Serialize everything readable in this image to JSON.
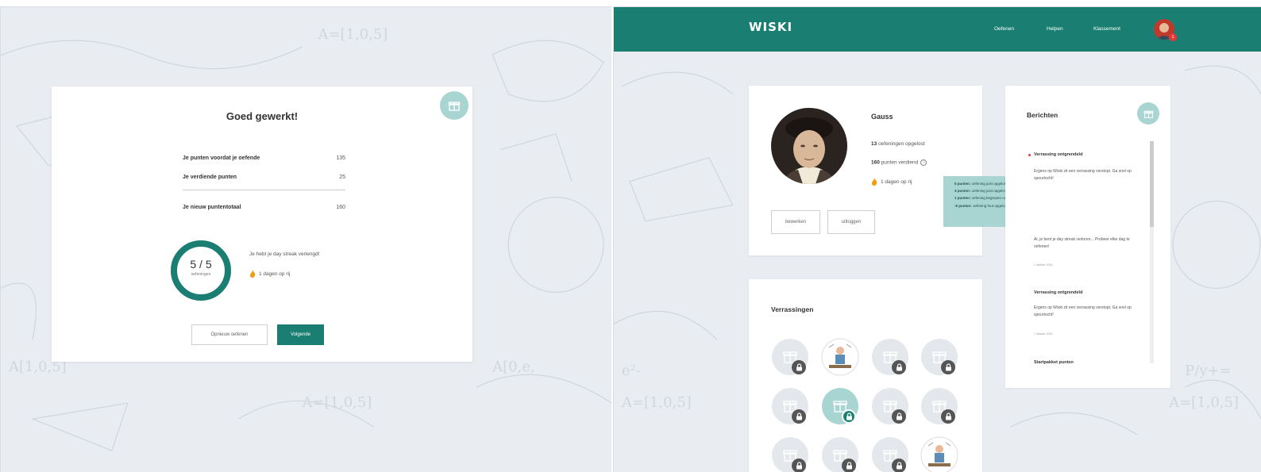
{
  "completion": {
    "title": "Goed gewerkt!",
    "rows": [
      {
        "label": "Je punten voordat je oefende",
        "value": "135"
      },
      {
        "label": "Je verdiende punten",
        "value": "25"
      }
    ],
    "total": {
      "label": "Je nieuw puntentotaal",
      "value": "160"
    },
    "progress": {
      "value_text": "5 / 5",
      "label": "oefeningen",
      "done": 5,
      "total": 5
    },
    "streak_message": "Je hebt je day streak verlengd!",
    "streak": "1 dagen op rij",
    "buttons": {
      "retry": "Opnieuw oefenen",
      "next": "Volgende"
    }
  },
  "header": {
    "logo": "WISKI",
    "nav": [
      "Oefenen",
      "Helpen",
      "Klassement"
    ],
    "notification_count": "1"
  },
  "profile": {
    "name": "Gauss",
    "exercises_count": "13",
    "exercises_label": "oefeningen opgelost",
    "points_count": "160",
    "points_label": "punten verdiend",
    "streak": "1 dagen op rij",
    "buttons": {
      "edit": "bewerken",
      "logout": "uitloggen"
    },
    "tooltip": [
      {
        "points": "5 punten:",
        "text": "oefening juist opgelost zonder hulp"
      },
      {
        "points": "3 punten:",
        "text": "oefening juist opgelost met hulp"
      },
      {
        "points": "1 punten:",
        "text": "oefening begrepen na hulp vragen"
      },
      {
        "points": "-5 punten:",
        "text": "oefening fout opgelost"
      }
    ]
  },
  "surprises": {
    "title": "Verrassingen"
  },
  "messages": {
    "title": "Berichten",
    "items": [
      {
        "title": "Verrassing ontgrendeld",
        "body": "Ergens op Wiski zit een verrassing verstopt. Ga snel op speurtocht!",
        "date": "",
        "unread": true
      },
      {
        "title": "",
        "body": "Ai, je bent je day streak verloren... Probeer elke dag te oefenen!",
        "date": "1 oktober 2019",
        "unread": false
      },
      {
        "title": "Verrassing ontgrendeld",
        "body": "Ergens op Wiski zit een verrassing verstopt. Ga snel op speurtocht!",
        "date": "1 oktober 2019",
        "unread": false
      },
      {
        "title": "Startpakket punten",
        "body": "",
        "date": "",
        "unread": false
      }
    ]
  },
  "colors": {
    "primary": "#1a7f72",
    "accent_light": "#a8d5d1",
    "background": "#e9edf2",
    "badge": "#e53935"
  }
}
